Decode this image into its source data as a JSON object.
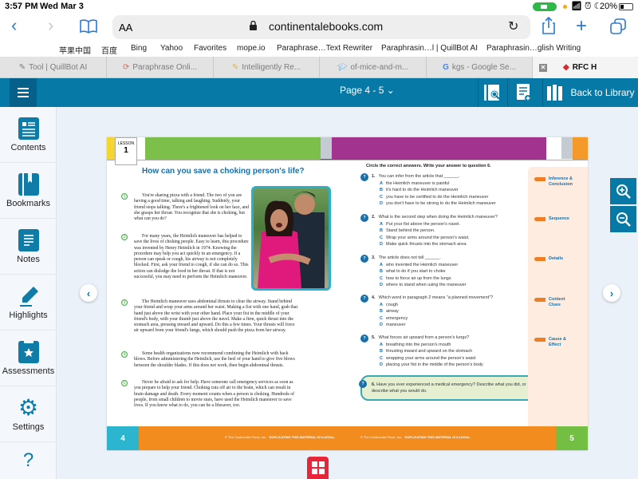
{
  "status_bar": {
    "time": "3:57 PM",
    "date": "Wed Mar 3",
    "battery": "20%"
  },
  "browser": {
    "text_size_label": "AA",
    "url": "continentalebooks.com",
    "bookmarks": [
      "苹果中国",
      "百度",
      "Bing",
      "Yahoo",
      "Favorites",
      "mope.io",
      "Paraphrase…Text Rewriter",
      "Paraphrasin…l | QuillBot AI",
      "Paraphrasin…glish Writing"
    ],
    "tabs": [
      {
        "label": "Tool | QuillBot AI",
        "icon": "quill-icon"
      },
      {
        "label": "Paraphrase Onli...",
        "icon": "paraphrase-icon"
      },
      {
        "label": "Intelligently Re...",
        "icon": "rewrite-icon"
      },
      {
        "label": "of-mice-and-m...",
        "icon": "graduation-cap-icon"
      },
      {
        "label": "kgs - Google Se...",
        "icon": "google-icon"
      },
      {
        "label": "RFC H",
        "icon": "rfc-icon",
        "active": true
      }
    ]
  },
  "app": {
    "page_selector": "Page 4 - 5",
    "back_to_library": "Back to Library",
    "sidebar": [
      {
        "label": "Contents",
        "icon": "contents-icon"
      },
      {
        "label": "Bookmarks",
        "icon": "bookmark-icon"
      },
      {
        "label": "Notes",
        "icon": "notes-icon"
      },
      {
        "label": "Highlights",
        "icon": "highlighter-icon"
      },
      {
        "label": "Assessments",
        "icon": "assessment-icon"
      },
      {
        "label": "Settings",
        "icon": "gear-icon"
      },
      {
        "label": "?",
        "icon": "help-icon"
      }
    ]
  },
  "book": {
    "lesson_label": "LESSON",
    "lesson_number": "1",
    "title": "How can you save a choking person's life?",
    "paragraphs": [
      {
        "num": "1",
        "text": "You're sharing pizza with a friend. The two of you are having a good time, talking and laughing. Suddenly, your friend stops talking. There's a frightened look on her face, and she grasps her throat. You recognize that she is choking, but what can you do?"
      },
      {
        "num": "2",
        "text": "For many years, the Heimlich maneuver has helped to save the lives of choking people. Easy to learn, this procedure was invented by Henry Heimlich in 1974. Knowing the procedure may help you act quickly in an emergency. If a person can speak or cough, his airway is not completely blocked. First, ask your friend to cough, if she can do so. This action can dislodge the food in her throat. If that is not successful, you may need to perform the Heimlich maneuver."
      },
      {
        "num": "3",
        "text": "The Heimlich maneuver uses abdominal thrusts to clear the airway. Stand behind your friend and wrap your arms around her waist. Making a fist with one hand, grab that hand just above the wrist with your other hand. Place your fist in the middle of your friend's body, with your thumb just above the navel. Make a firm, quick thrust into the stomach area, pressing inward and upward. Do this a few times. Your thrusts will force air upward from your friend's lungs, which should push the pizza from her airway."
      },
      {
        "num": "4",
        "text": "Some health organizations now recommend combining the Heimlich with back blows. Before administering the Heimlich, use the heel of your hand to give five blows between the shoulder blades. If this does not work, then begin abdominal thrusts."
      },
      {
        "num": "5",
        "text": "Never be afraid to ask for help. Have someone call emergency services as soon as you prepare to help your friend. Choking cuts off air to the brain, which can result in brain damage and death. Every moment counts when a person is choking. Hundreds of people, from small children to movie stars, have used the Heimlich maneuver to save lives. If you know what to do, you can be a lifesaver, too."
      }
    ],
    "instructions": "Circle the correct answers. Write your answer to question 6.",
    "questions": [
      {
        "num": "1.",
        "text": "You can infer from the article that ______.",
        "options": [
          {
            "letter": "A",
            "text": "the Heimlich maneuver is painful"
          },
          {
            "letter": "B",
            "text": "it's hard to do the Heimlich maneuver"
          },
          {
            "letter": "C",
            "text": "you have to be certified to do the Heimlich maneuver"
          },
          {
            "letter": "D",
            "text": "you don't have to be strong to do the Heimlich maneuver"
          }
        ]
      },
      {
        "num": "2.",
        "text": "What is the second step when doing the Heimlich maneuver?",
        "options": [
          {
            "letter": "A",
            "text": "Put your fist above the person's navel."
          },
          {
            "letter": "B",
            "text": "Stand behind the person."
          },
          {
            "letter": "C",
            "text": "Wrap your arms around the person's waist."
          },
          {
            "letter": "D",
            "text": "Make quick thrusts into the stomach area."
          }
        ]
      },
      {
        "num": "3.",
        "text": "The article does not tell ______.",
        "options": [
          {
            "letter": "A",
            "text": "who invented the Heimlich maneuver"
          },
          {
            "letter": "B",
            "text": "what to do if you start to choke"
          },
          {
            "letter": "C",
            "text": "how to force air up from the lungs"
          },
          {
            "letter": "D",
            "text": "where to stand when using the maneuver"
          }
        ]
      },
      {
        "num": "4.",
        "text": "Which word in paragraph 2 means \"a planned movement\"?",
        "options": [
          {
            "letter": "A",
            "text": "cough"
          },
          {
            "letter": "B",
            "text": "airway"
          },
          {
            "letter": "C",
            "text": "emergency"
          },
          {
            "letter": "D",
            "text": "maneuver"
          }
        ]
      },
      {
        "num": "5.",
        "text": "What forces air upward from a person's lungs?",
        "options": [
          {
            "letter": "A",
            "text": "breathing into the person's mouth"
          },
          {
            "letter": "B",
            "text": "thrusting inward and upward on the stomach"
          },
          {
            "letter": "C",
            "text": "wrapping your arms around the person's waist"
          },
          {
            "letter": "D",
            "text": "placing your fist in the middle of the person's body"
          }
        ]
      }
    ],
    "question6": {
      "num": "6.",
      "text": "Have you ever experienced a medical emergency? Describe what you did, or describe what you would do."
    },
    "skills": [
      "Inference & Conclusion",
      "Sequence",
      "Details",
      "Context Clues",
      "Cause & Effect"
    ],
    "footer": {
      "left_page": "4",
      "right_page": "5",
      "copyright": "© The Continental Press, Inc.",
      "notice": "DUPLICATING THIS MATERIAL IS ILLEGAL."
    }
  }
}
